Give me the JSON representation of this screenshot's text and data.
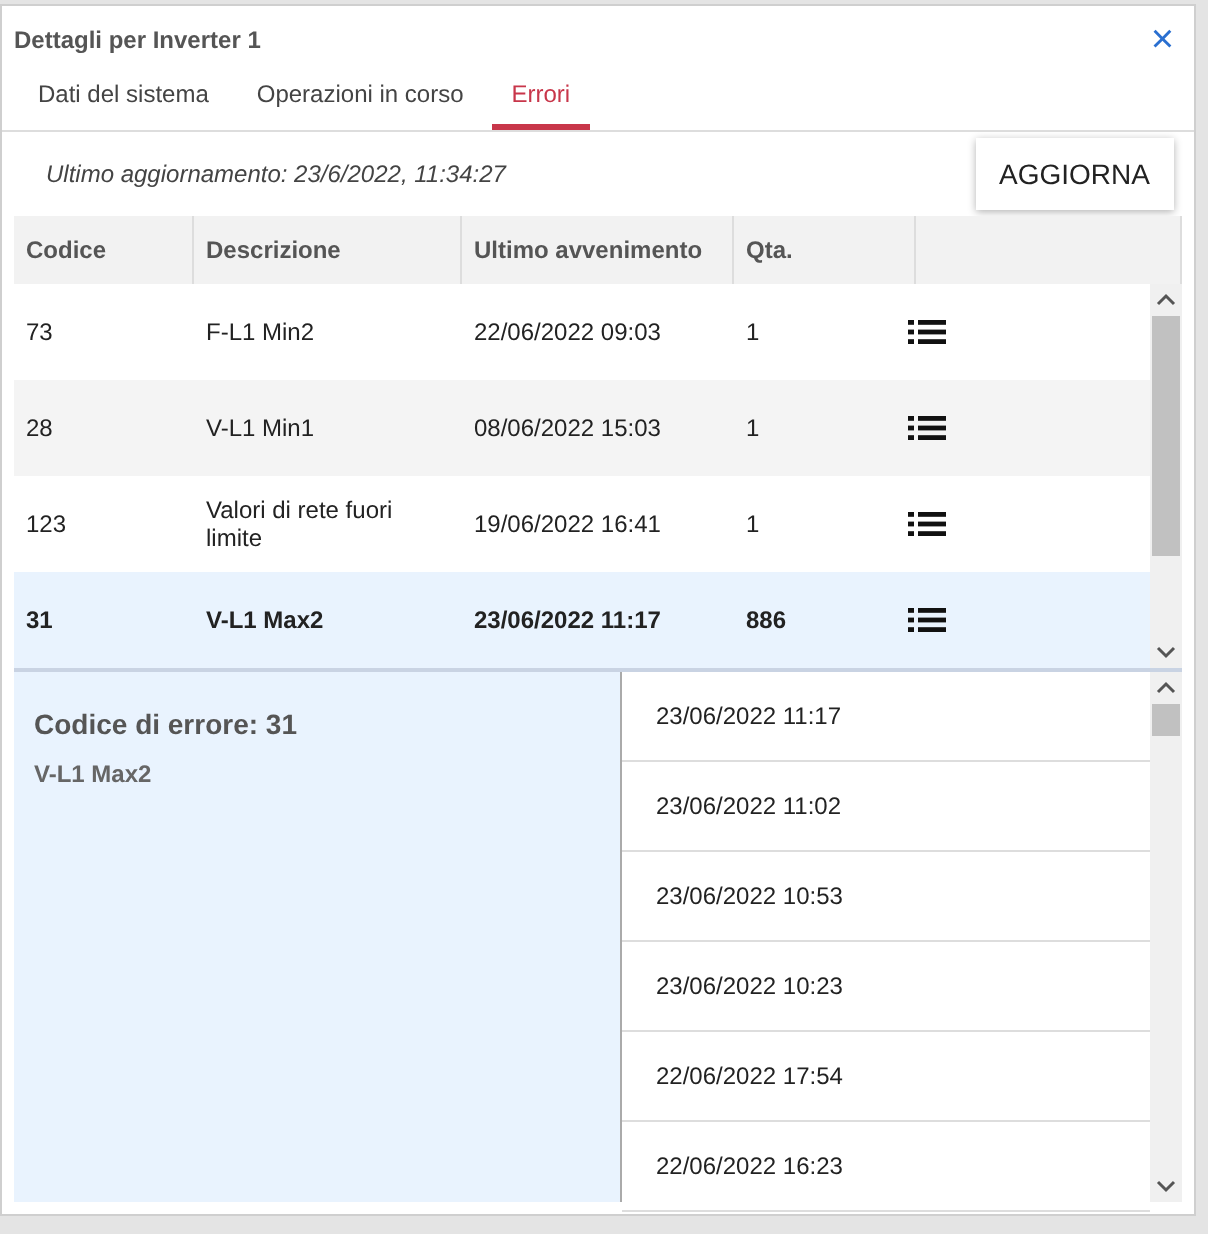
{
  "window": {
    "title": "Dettagli per Inverter 1",
    "close": "×"
  },
  "tabs": [
    {
      "label": "Dati del sistema",
      "selected": false
    },
    {
      "label": "Operazioni in corso",
      "selected": false
    },
    {
      "label": "Errori",
      "selected": true
    }
  ],
  "toolbar": {
    "last_update": "Ultimo aggiornamento: 23/6/2022, 11:34:27",
    "refresh_button": "AGGIORNA"
  },
  "table": {
    "columns": [
      "Codice",
      "Descrizione",
      "Ultimo avvenimento",
      "Qta."
    ],
    "rows": [
      {
        "code": "73",
        "description": "F-L1 Min2",
        "last": "22/06/2022 09:03",
        "qty": "1",
        "selected": false
      },
      {
        "code": "28",
        "description": "V-L1 Min1",
        "last": "08/06/2022 15:03",
        "qty": "1",
        "selected": false
      },
      {
        "code": "123",
        "description": "Valori di rete fuori limite",
        "last": "19/06/2022 16:41",
        "qty": "1",
        "selected": false
      },
      {
        "code": "31",
        "description": "V-L1 Max2",
        "last": "23/06/2022 11:17",
        "qty": "886",
        "selected": true
      }
    ]
  },
  "detail": {
    "title": "Codice di errore: 31",
    "subtitle": "V-L1 Max2",
    "occurrences": [
      "23/06/2022 11:17",
      "23/06/2022 11:02",
      "23/06/2022 10:53",
      "23/06/2022 10:23",
      "22/06/2022 17:54",
      "22/06/2022 16:23"
    ]
  }
}
